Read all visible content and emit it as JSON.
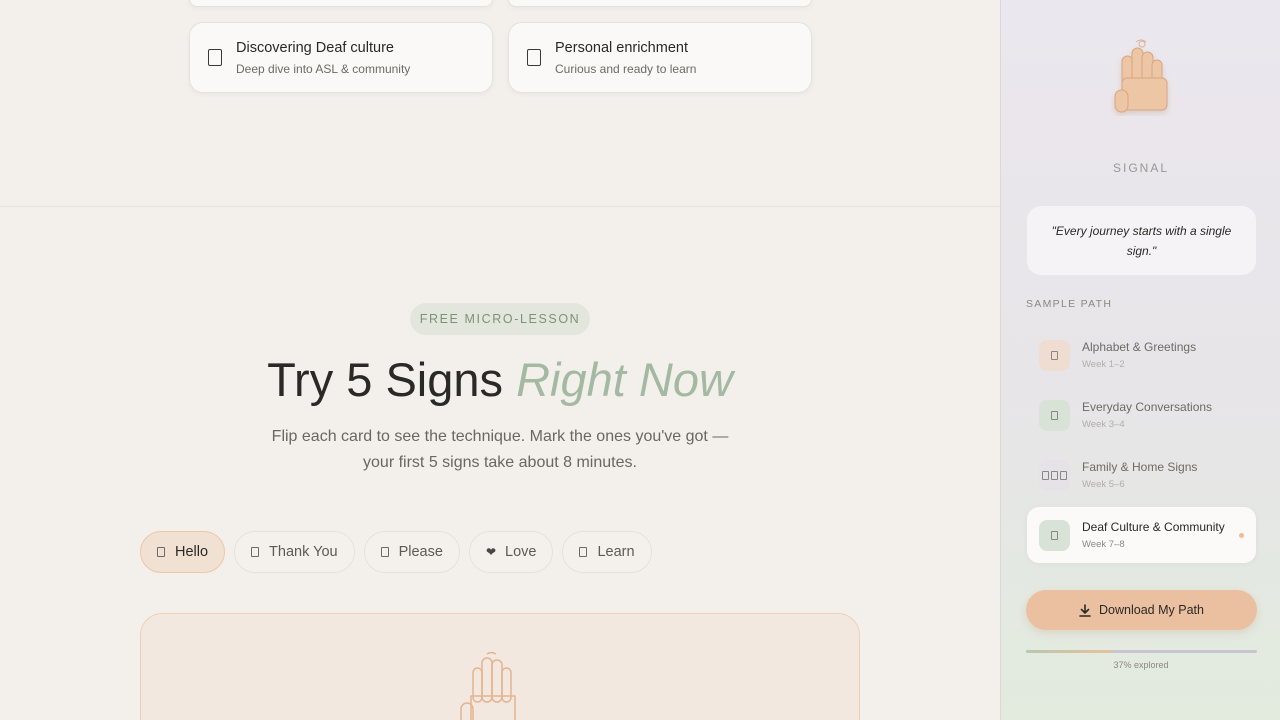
{
  "goals": {
    "top_row": [
      "",
      ""
    ],
    "cards": [
      {
        "title": "Discovering Deaf culture",
        "subtitle": "Deep dive into ASL & community"
      },
      {
        "title": "Personal enrichment",
        "subtitle": "Curious and ready to learn"
      }
    ]
  },
  "lesson": {
    "badge": "FREE MICRO-LESSON",
    "headline_plain": "Try 5 Signs",
    "headline_accent": "Right Now",
    "lede": "Flip each card to see the technique. Mark the ones you've got — your first 5 signs take about 8 minutes.",
    "tabs": [
      {
        "label": "Hello",
        "icon": "card-icon",
        "active": true
      },
      {
        "label": "Thank You",
        "icon": "card-icon",
        "active": false
      },
      {
        "label": "Please",
        "icon": "card-icon",
        "active": false
      },
      {
        "label": "Love",
        "icon": "heart-icon",
        "active": false
      },
      {
        "label": "Learn",
        "icon": "card-icon",
        "active": false
      }
    ],
    "card_icon": "raised-hand-icon"
  },
  "sidebar": {
    "logo_icon": "raised-hand-icon",
    "brand": "SIGNAL",
    "quote": "\"Every journey starts with a single sign.\"",
    "section_label": "SAMPLE PATH",
    "path": [
      {
        "title": "Alphabet & Greetings",
        "week": "Week 1–2",
        "tint": "#f0ddd2",
        "icon": "card-icon",
        "current": false
      },
      {
        "title": "Everyday Conversations",
        "week": "Week 3–4",
        "tint": "#d9e2d6",
        "icon": "card-icon",
        "current": false
      },
      {
        "title": "Family & Home Signs",
        "week": "Week 5–6",
        "tint": "#e6e3e8",
        "icon": "family-icon",
        "current": false
      },
      {
        "title": "Deaf Culture & Community",
        "week": "Week 7–8",
        "tint": "#d9e2d6",
        "icon": "card-icon",
        "current": true
      }
    ],
    "download_label": "Download My Path",
    "progress_fraction": 0.37,
    "progress_text": "37% explored"
  },
  "colors": {
    "accent_green": "#a4b9a1",
    "accent_peach": "#eac0a1",
    "background": "#f3f0ec"
  }
}
